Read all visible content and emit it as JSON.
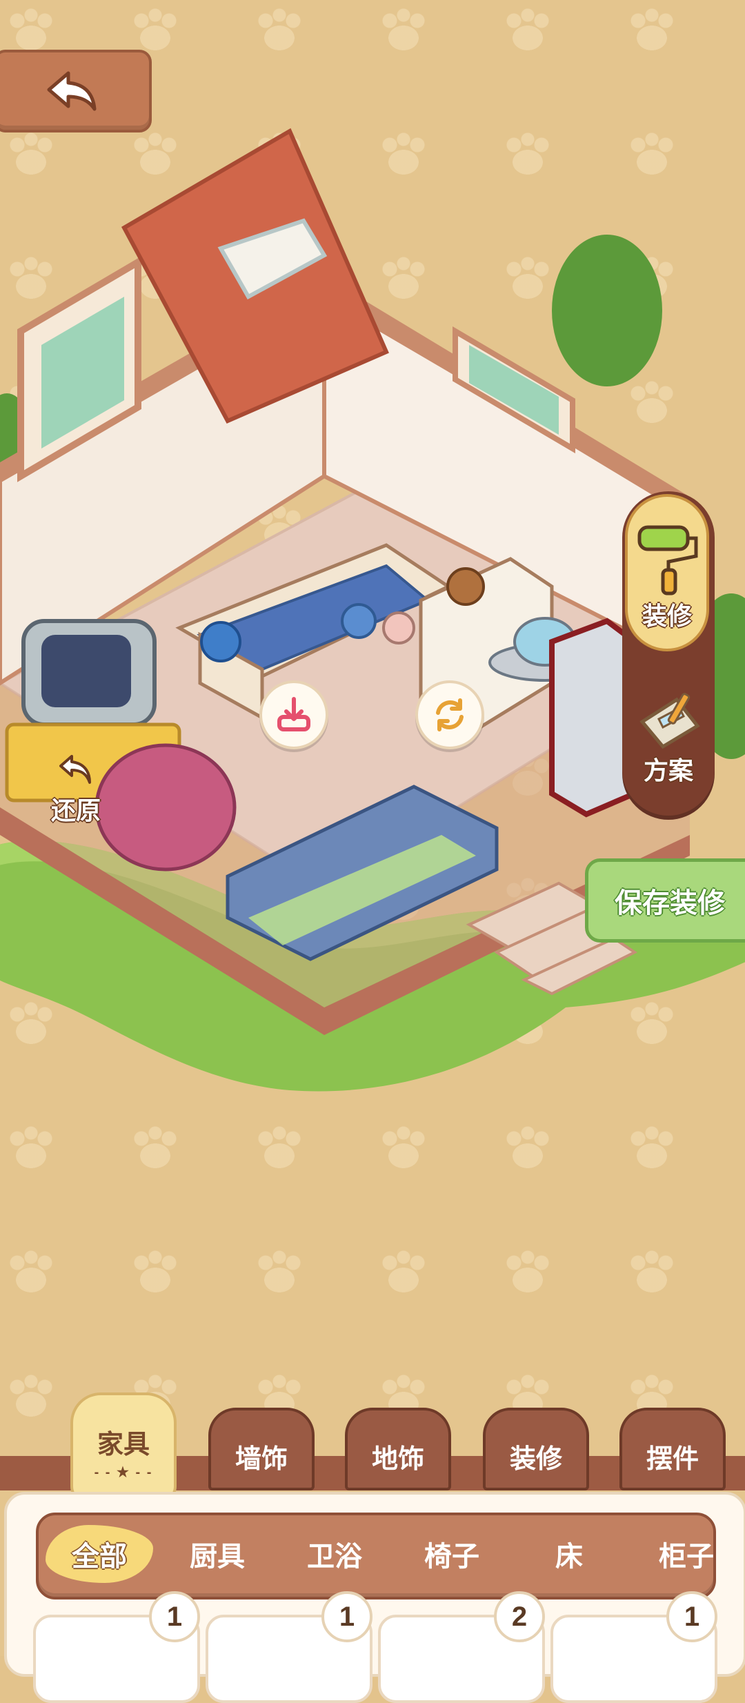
{
  "colors": {
    "background": "#e4c58e",
    "panel_brown": "#7b3e2d",
    "tab_brown": "#9a5a44",
    "active_yellow": "#f7e3a0",
    "save_green": "#a9d87c",
    "grass_green": "#8cc24f"
  },
  "toolbar": {
    "back_icon": "back-arrow-icon"
  },
  "scene": {
    "restore_label": "还原",
    "restore_icon": "undo-icon",
    "store_icon": "download-icon",
    "rotate_icon": "rotate-icon"
  },
  "side_menu": {
    "items": [
      {
        "label": "装修",
        "icon": "paint-roller-icon"
      },
      {
        "label": "方案",
        "icon": "blueprint-icon"
      }
    ]
  },
  "save_button": {
    "label": "保存装修"
  },
  "category_tabs": [
    {
      "label": "家具"
    },
    {
      "label": "墙饰"
    },
    {
      "label": "地饰"
    },
    {
      "label": "装修"
    },
    {
      "label": "摆件"
    }
  ],
  "filters": [
    {
      "label": "全部"
    },
    {
      "label": "厨具"
    },
    {
      "label": "卫浴"
    },
    {
      "label": "椅子"
    },
    {
      "label": "床"
    },
    {
      "label": "柜子"
    }
  ],
  "items": [
    {
      "count": "1"
    },
    {
      "count": "1"
    },
    {
      "count": "2"
    },
    {
      "count": "1"
    }
  ]
}
